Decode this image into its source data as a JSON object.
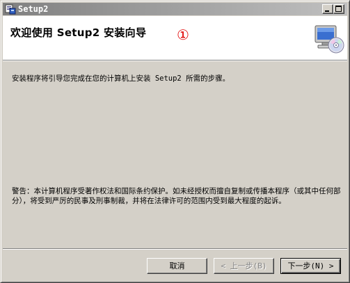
{
  "window": {
    "title": "Setup2",
    "controls": {
      "minimize": "minimize",
      "maximize": "maximize",
      "close": "close"
    }
  },
  "header": {
    "title": "欢迎使用 Setup2 安装向导",
    "badge": "①",
    "icon": "computer-with-cd-icon"
  },
  "body": {
    "intro": "安装程序将引导您完成在您的计算机上安装 Setup2 所需的步骤。",
    "warning": "警告：本计算机程序受著作权法和国际条约保护。如未经授权而擅自复制或传播本程序（或其中任何部分），将受到严厉的民事及刑事制裁，并将在法律许可的范围内受到最大程度的起诉。"
  },
  "buttons": {
    "cancel": "取消",
    "back": "< 上一步(B)",
    "next": "下一步(N) >"
  },
  "colors": {
    "face": "#d4d0c8",
    "header_bg": "#ffffff",
    "badge": "#e00000",
    "title_gradient_start": "#808080",
    "title_gradient_end": "#c0c0c0"
  }
}
